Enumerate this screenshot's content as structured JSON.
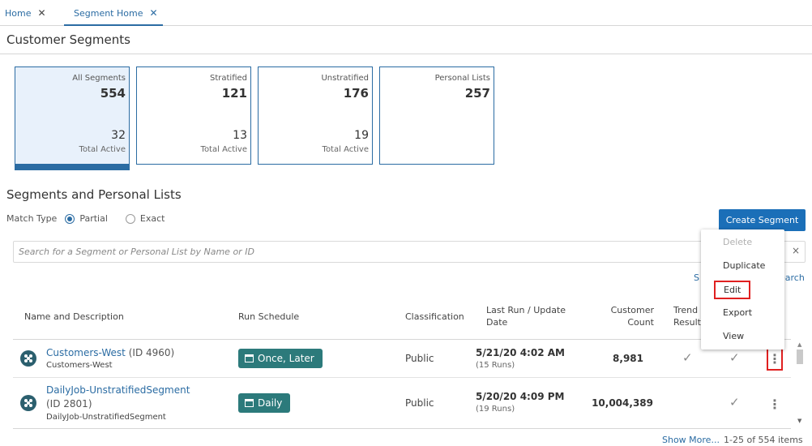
{
  "tabs": [
    {
      "label": "Home",
      "close": "✕"
    },
    {
      "label": "Segment Home",
      "close": "✕"
    }
  ],
  "page_title": "Customer Segments",
  "cards": [
    {
      "label": "All Segments",
      "count": "554",
      "active": "32",
      "active_label": "Total Active"
    },
    {
      "label": "Stratified",
      "count": "121",
      "active": "13",
      "active_label": "Total Active"
    },
    {
      "label": "Unstratified",
      "count": "176",
      "active": "19",
      "active_label": "Total Active"
    },
    {
      "label": "Personal Lists",
      "count": "257"
    }
  ],
  "section_title": "Segments and Personal Lists",
  "match": {
    "label": "Match Type",
    "partial": "Partial",
    "exact": "Exact",
    "selected": "Partial"
  },
  "create_button": "Create Segment",
  "search": {
    "placeholder": "Search for a Segment or Personal List by Name or ID",
    "clear": "×"
  },
  "links": {
    "s_fragment": "S",
    "search_fragment": "earch"
  },
  "menu": {
    "items": [
      {
        "label": "Delete",
        "disabled": true
      },
      {
        "label": "Duplicate"
      },
      {
        "label": "Edit"
      },
      {
        "label": "Export"
      },
      {
        "label": "View"
      }
    ]
  },
  "table": {
    "headers": {
      "name": "Name and Description",
      "schedule": "Run Schedule",
      "classification": "Classification",
      "last_run_1": "Last Run / Update",
      "last_run_2": "Date",
      "count_1": "Customer",
      "count_2": "Count",
      "trend_1": "Trend",
      "trend_2": "Results"
    },
    "rows": [
      {
        "name": "Customers-West",
        "id": "(ID 4960)",
        "description": "Customers-West",
        "schedule": "Once, Later",
        "classification": "Public",
        "last_run": "5/21/20 4:02 AM",
        "runs": "(15 Runs)",
        "count": "8,981"
      },
      {
        "name": "DailyJob-UnstratifiedSegment",
        "id": "(ID 2801)",
        "description": "DailyJob-UnstratifiedSegment",
        "schedule": "Daily",
        "classification": "Public",
        "last_run": "5/20/20 4:09 PM",
        "runs": "(19 Runs)",
        "count": "10,004,389"
      }
    ]
  },
  "footer": {
    "show_more": "Show More...",
    "items": "1-25 of 554 items"
  },
  "icons": {
    "check": "✓",
    "kebab": "⋮",
    "scroll_up": "▲",
    "scroll_down": "▼"
  }
}
